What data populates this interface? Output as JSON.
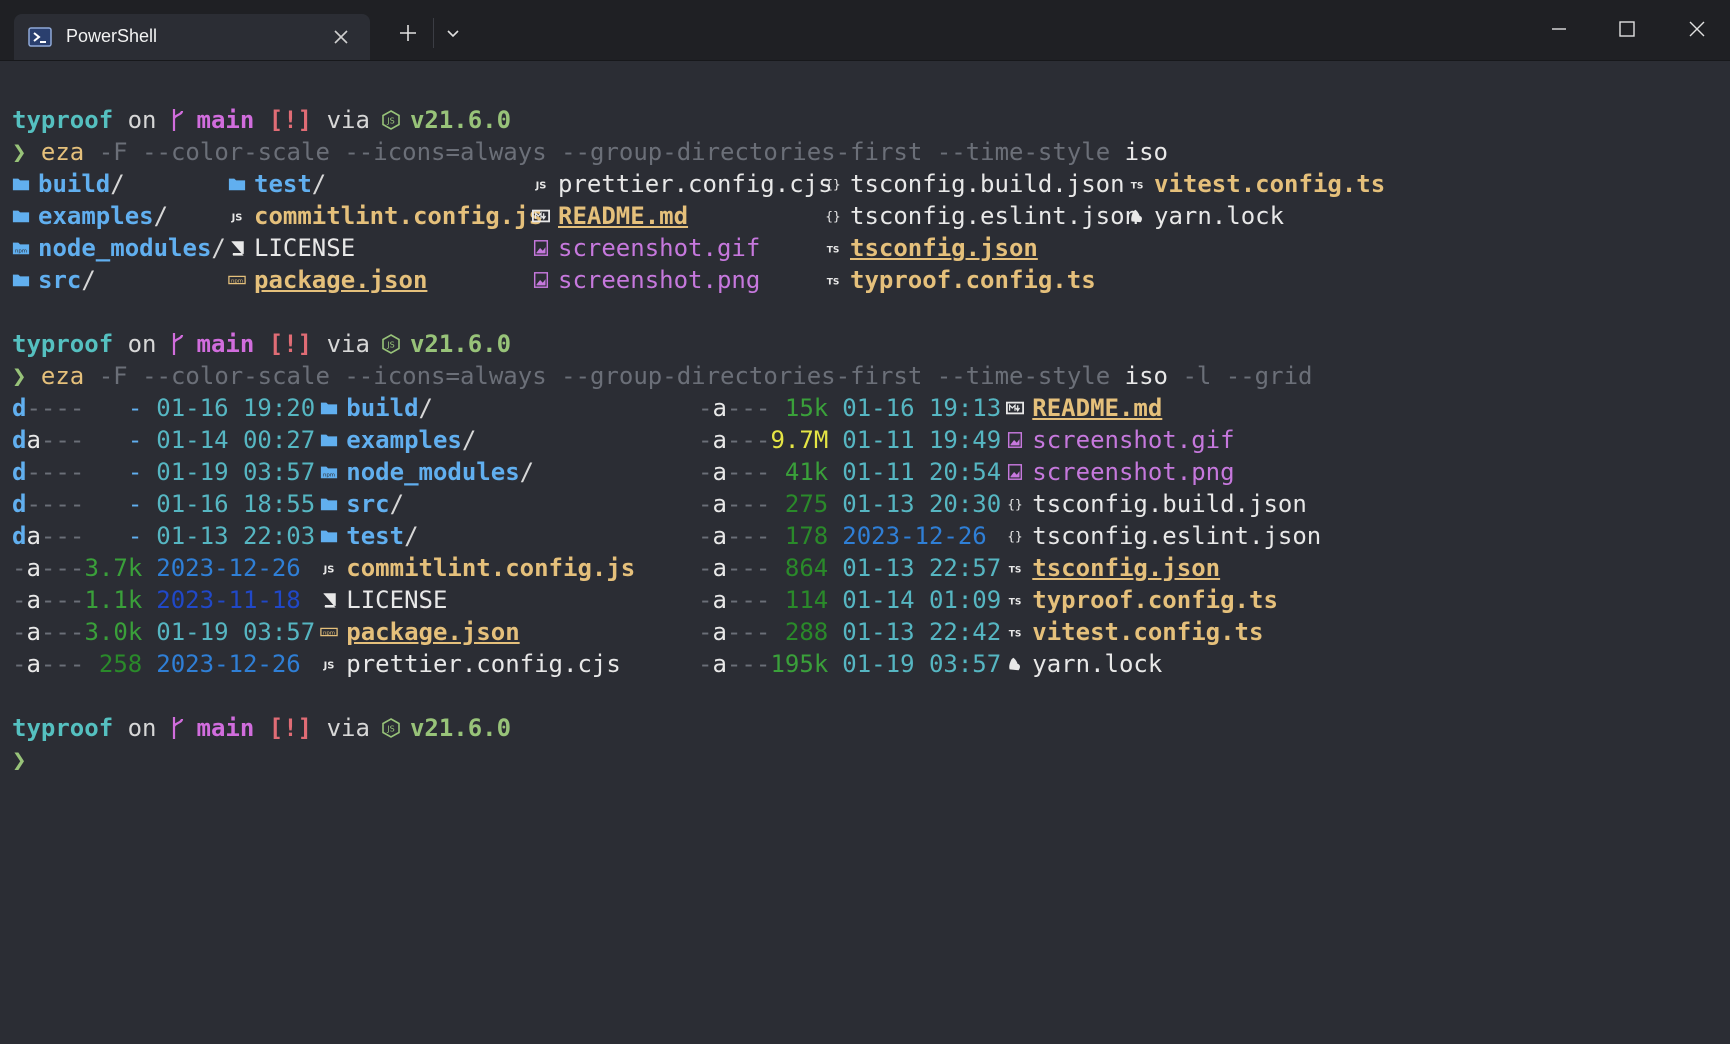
{
  "window": {
    "tab_title": "PowerShell",
    "tab_icon": "powershell-icon"
  },
  "prompt": {
    "dir": "typroof",
    "on": "on",
    "branch": "main",
    "status": "[!]",
    "via": "via",
    "node_version": "v21.6.0",
    "symbol": "❯"
  },
  "cmd1": {
    "cmd": "eza",
    "args_dim1": "-F --color-scale --icons=always --group-directories-first --time-style",
    "args_white": "iso"
  },
  "cmd2": {
    "cmd": "eza",
    "args_dim1": "-F --color-scale --icons=always --group-directories-first --time-style",
    "args_white": "iso",
    "args_dim2": "-l --grid"
  },
  "grid": {
    "col1": [
      "build",
      "examples",
      "node_modules",
      "src"
    ],
    "col2": [
      "test",
      "commitlint.config.js",
      "LICENSE",
      "package.json"
    ],
    "col3": [
      "prettier.config.cjs",
      "README.md",
      "screenshot.gif",
      "screenshot.png"
    ],
    "col4": [
      "tsconfig.build.json",
      "tsconfig.eslint.json",
      "tsconfig.json",
      "typroof.config.ts"
    ],
    "col5": [
      "vitest.config.ts",
      "yarn.lock"
    ]
  },
  "long_left": [
    {
      "perm": "d----",
      "size": "-",
      "date": "01-16 19:20",
      "name": "build",
      "slash": "/"
    },
    {
      "perm": "da---",
      "size": "-",
      "date": "01-14 00:27",
      "name": "examples",
      "slash": "/"
    },
    {
      "perm": "d----",
      "size": "-",
      "date": "01-19 03:57",
      "name": "node_modules",
      "slash": "/"
    },
    {
      "perm": "d----",
      "size": "-",
      "date": "01-16 18:55",
      "name": "src",
      "slash": "/"
    },
    {
      "perm": "da---",
      "size": "-",
      "date": "01-13 22:03",
      "name": "test",
      "slash": "/"
    },
    {
      "perm": "-a---",
      "size": "3.7k",
      "date": "2023-12-26",
      "name": "commitlint.config.js",
      "slash": ""
    },
    {
      "perm": "-a---",
      "size": "1.1k",
      "date": "2023-11-18",
      "name": "LICENSE",
      "slash": ""
    },
    {
      "perm": "-a---",
      "size": "3.0k",
      "date": "01-19 03:57",
      "name": "package.json",
      "slash": ""
    },
    {
      "perm": "-a---",
      "size": "258",
      "date": "2023-12-26",
      "name": "prettier.config.cjs",
      "slash": ""
    }
  ],
  "long_right": [
    {
      "perm": "-a---",
      "size": "15k",
      "date": "01-16 19:13",
      "name": "README.md"
    },
    {
      "perm": "-a---",
      "size": "9.7M",
      "date": "01-11 19:49",
      "name": "screenshot.gif"
    },
    {
      "perm": "-a---",
      "size": "41k",
      "date": "01-11 20:54",
      "name": "screenshot.png"
    },
    {
      "perm": "-a---",
      "size": "275",
      "date": "01-13 20:30",
      "name": "tsconfig.build.json"
    },
    {
      "perm": "-a---",
      "size": "178",
      "date": "2023-12-26",
      "name": "tsconfig.eslint.json"
    },
    {
      "perm": "-a---",
      "size": "864",
      "date": "01-13 22:57",
      "name": "tsconfig.json"
    },
    {
      "perm": "-a---",
      "size": "114",
      "date": "01-14 01:09",
      "name": "typroof.config.ts"
    },
    {
      "perm": "-a---",
      "size": "288",
      "date": "01-13 22:42",
      "name": "vitest.config.ts"
    },
    {
      "perm": "-a---",
      "size": "195k",
      "date": "01-19 03:57",
      "name": "yarn.lock"
    }
  ],
  "colors": {
    "background": "#2b2d34",
    "titlebar": "#1f2024",
    "dir": "#61afef",
    "prompt_dir": "#55c0c0",
    "branch": "#d16ddd",
    "status": "#e06c75",
    "node": "#98c379",
    "js_file": "#e5c07b",
    "image_file": "#c678dd"
  }
}
